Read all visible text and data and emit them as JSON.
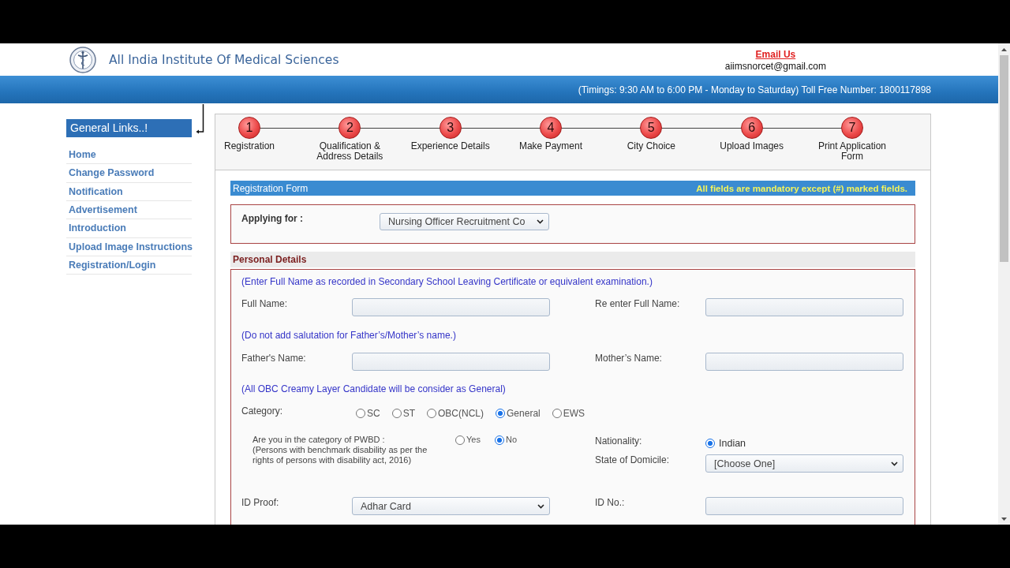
{
  "header": {
    "title": "All India Institute Of Medical Sciences",
    "email_link": "Email Us",
    "email": "aiimsnorcet@gmail.com"
  },
  "info_bar": {
    "text": "(Timings: 9:30 AM to 6:00 PM - Monday to Saturday) Toll Free Number: 1800117898"
  },
  "sidebar": {
    "title": "General Links..!",
    "items": [
      "Home",
      "Change Password",
      "Notification",
      "Advertisement",
      "Introduction",
      "Upload Image Instructions",
      "Registration/Login"
    ]
  },
  "steps": [
    {
      "number": "1",
      "label": "Registration"
    },
    {
      "number": "2",
      "label": "Qualification & Address Details"
    },
    {
      "number": "3",
      "label": "Experience Details"
    },
    {
      "number": "4",
      "label": "Make Payment"
    },
    {
      "number": "5",
      "label": "City Choice"
    },
    {
      "number": "6",
      "label": "Upload Images"
    },
    {
      "number": "7",
      "label": "Print Application Form"
    }
  ],
  "registration_form": {
    "title": "Registration Form",
    "note": "All fields are mandatory except (#) marked fields.",
    "applying_for": {
      "label": "Applying for :",
      "value": "Nursing Officer Recruitment Co"
    }
  },
  "personal_details": {
    "title": "Personal Details",
    "name_note": "(Enter Full Name as recorded in Secondary School Leaving Certificate or equivalent examination.)",
    "full_name": {
      "label": "Full Name:"
    },
    "re_full_name": {
      "label": "Re enter Full Name:"
    },
    "salutation_note": "(Do not add salutation for Father’s/Mother’s name.)",
    "father_name": {
      "label": "Father's Name:"
    },
    "mother_name": {
      "label": "Mother’s Name:"
    },
    "obc_note": "(All OBC Creamy Layer Candidate will be consider as General)",
    "category": {
      "label": "Category:",
      "options": [
        {
          "label": "SC",
          "selected": false
        },
        {
          "label": "ST",
          "selected": false
        },
        {
          "label": "OBC(NCL)",
          "selected": false
        },
        {
          "label": "General",
          "selected": true
        },
        {
          "label": "EWS",
          "selected": false
        }
      ]
    },
    "pwbd": {
      "question": "Are you in the category of PWBD :",
      "note": "(Persons with benchmark disability as per the rights of persons with disability act, 2016)",
      "options": [
        {
          "label": "Yes",
          "selected": false
        },
        {
          "label": "No",
          "selected": true
        }
      ]
    },
    "nationality": {
      "label": "Nationality:",
      "options": [
        {
          "label": "Indian",
          "selected": true
        }
      ]
    },
    "domicile": {
      "label": "State of Domicile:",
      "value": "[Choose One]"
    },
    "id_proof": {
      "label": "ID Proof:",
      "value": "Adhar Card"
    },
    "id_no": {
      "label": "ID No.:"
    }
  }
}
